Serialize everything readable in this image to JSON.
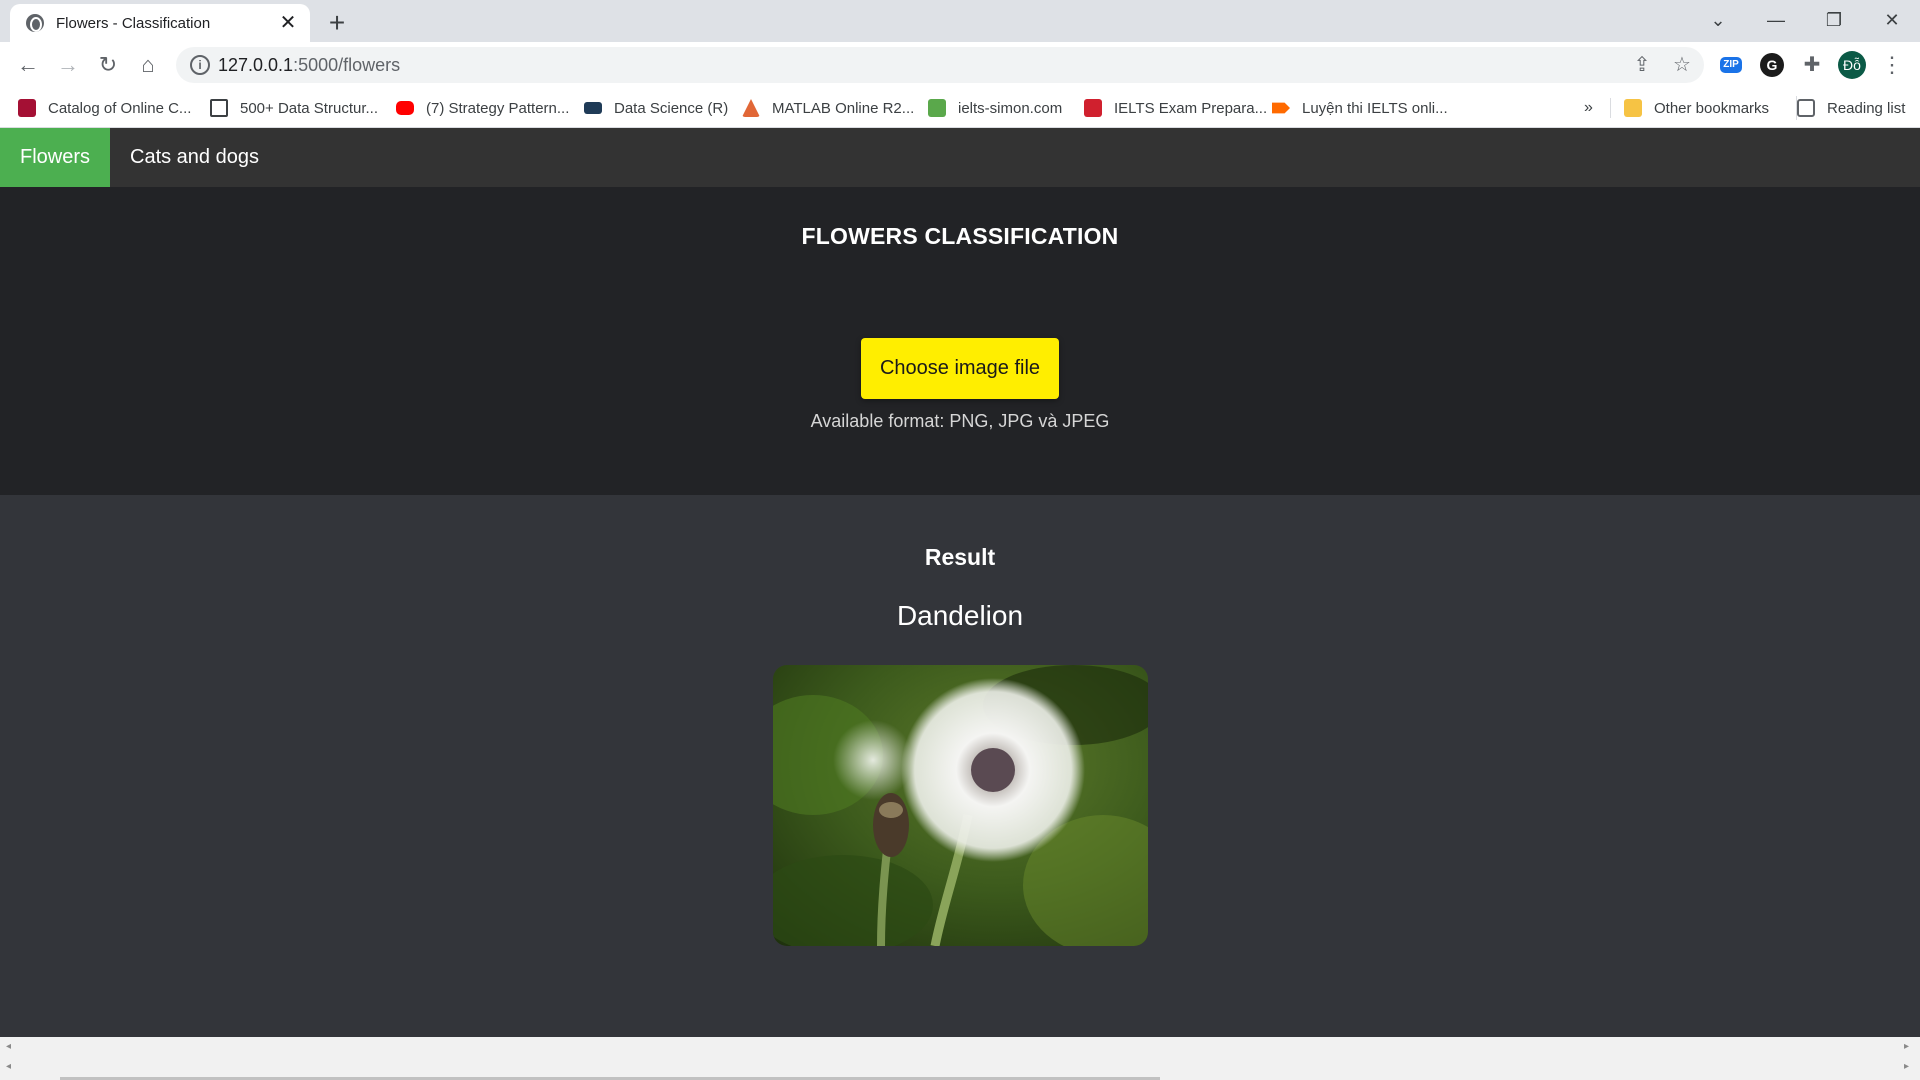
{
  "browser": {
    "tab_title": "Flowers - Classification",
    "tab_close": "✕",
    "new_tab": "+",
    "url_host": "127.0.0.1",
    "url_path": ":5000/flowers",
    "profile_initials": "Đỗ",
    "ext_zip": "ZIP",
    "ext_grammarly": "G"
  },
  "bookmarks": [
    {
      "label": "Catalog of Online C...",
      "color": "#a41034"
    },
    {
      "label": "500+ Data Structur...",
      "color": "#3c4043"
    },
    {
      "label": "(7) Strategy Pattern...",
      "color": "#ff0000"
    },
    {
      "label": "Data Science (R)",
      "color": "#1f3b57"
    },
    {
      "label": "MATLAB Online R2...",
      "color": "#e16737"
    },
    {
      "label": "ielts-simon.com",
      "color": "#5aa84b"
    },
    {
      "label": "IELTS Exam Prepara...",
      "color": "#d0202e"
    },
    {
      "label": "Luyện thi IELTS onli...",
      "color": "#ff6a00"
    }
  ],
  "bookmarks_overflow": "»",
  "other_bookmarks": "Other bookmarks",
  "reading_list": "Reading list",
  "nav": {
    "items": [
      {
        "label": "Flowers",
        "active": true
      },
      {
        "label": "Cats and dogs",
        "active": false
      }
    ]
  },
  "upload": {
    "title": "FLOWERS CLASSIFICATION",
    "button_label": "Choose image file",
    "formats_text": "Available format: PNG, JPG và JPEG"
  },
  "result": {
    "heading": "Result",
    "prediction": "Dandelion"
  },
  "colors": {
    "nav_active": "#4caf50",
    "button": "#ffee00",
    "upload_bg": "#222326",
    "result_bg": "#33353a"
  }
}
